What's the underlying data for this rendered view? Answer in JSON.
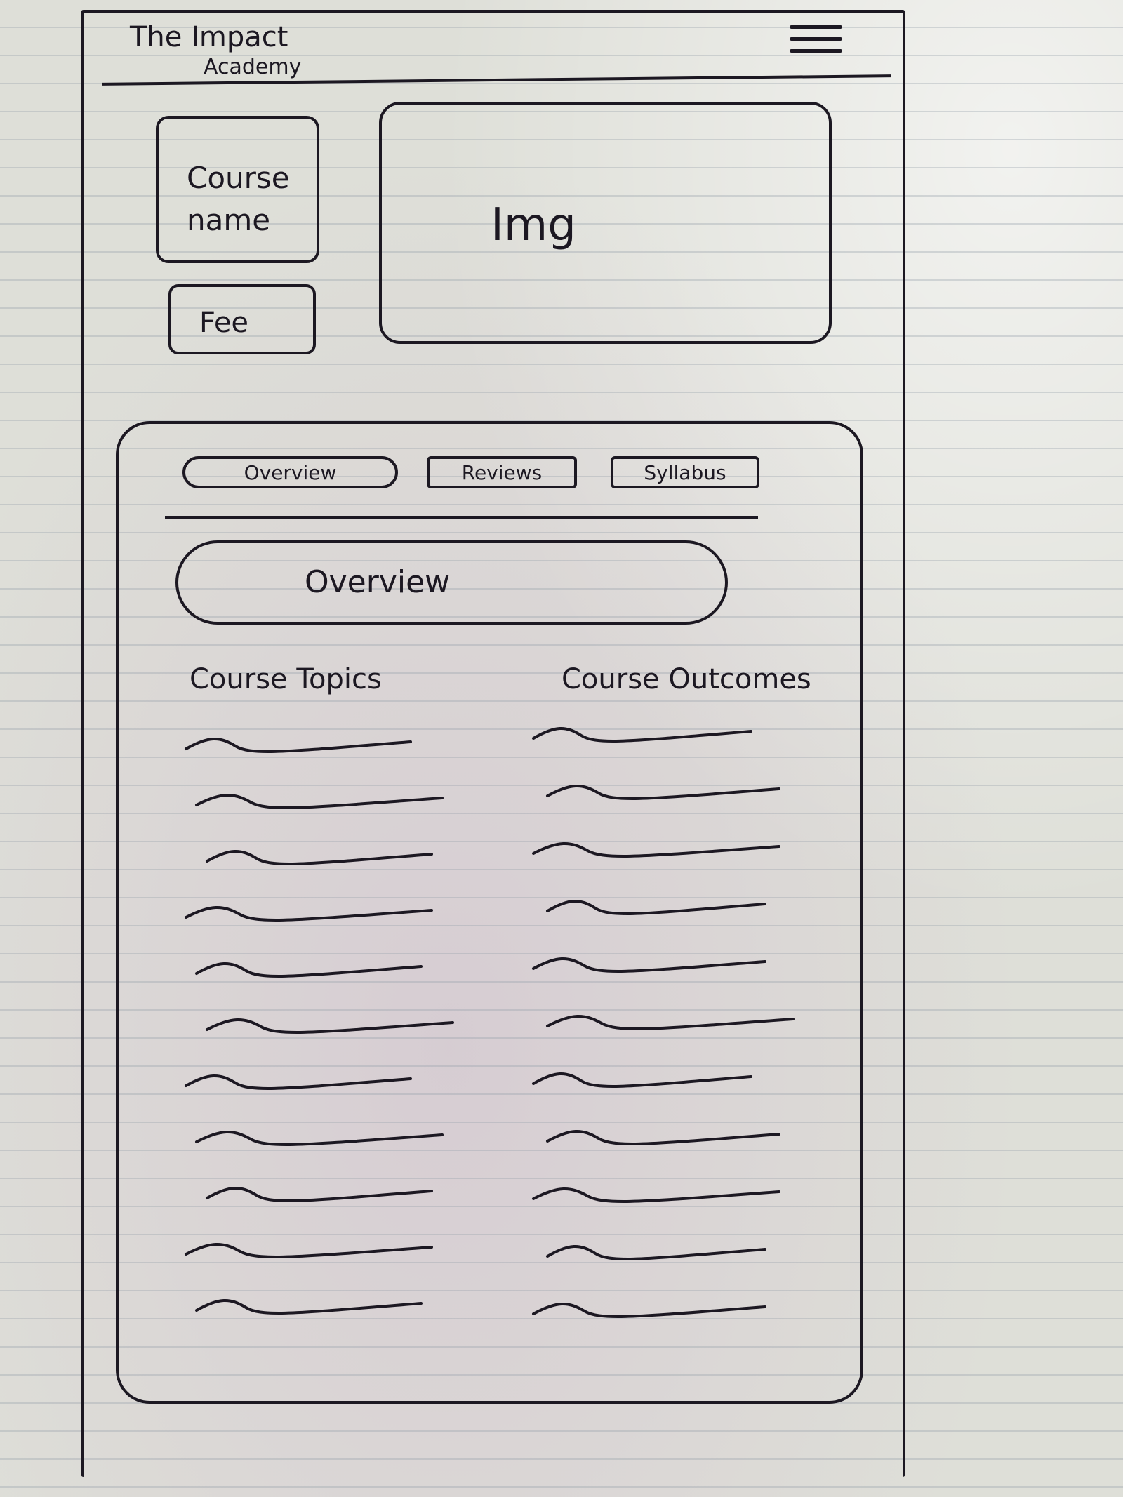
{
  "header": {
    "title_line1": "The Impact",
    "title_line2": "Academy",
    "menu_icon": "hamburger-menu-icon"
  },
  "hero": {
    "course_name": "Course name",
    "fee": "Fee",
    "image_label": "Img"
  },
  "tabs": [
    {
      "label": "Overview",
      "active": true
    },
    {
      "label": "Reviews"
    },
    {
      "label": "Syllabus"
    }
  ],
  "content": {
    "banner": "Overview",
    "topics_heading": "Course Topics",
    "outcomes_heading": "Course Outcomes"
  },
  "colors": {
    "ink": "#1c1822",
    "paper": "#dedfd8"
  }
}
